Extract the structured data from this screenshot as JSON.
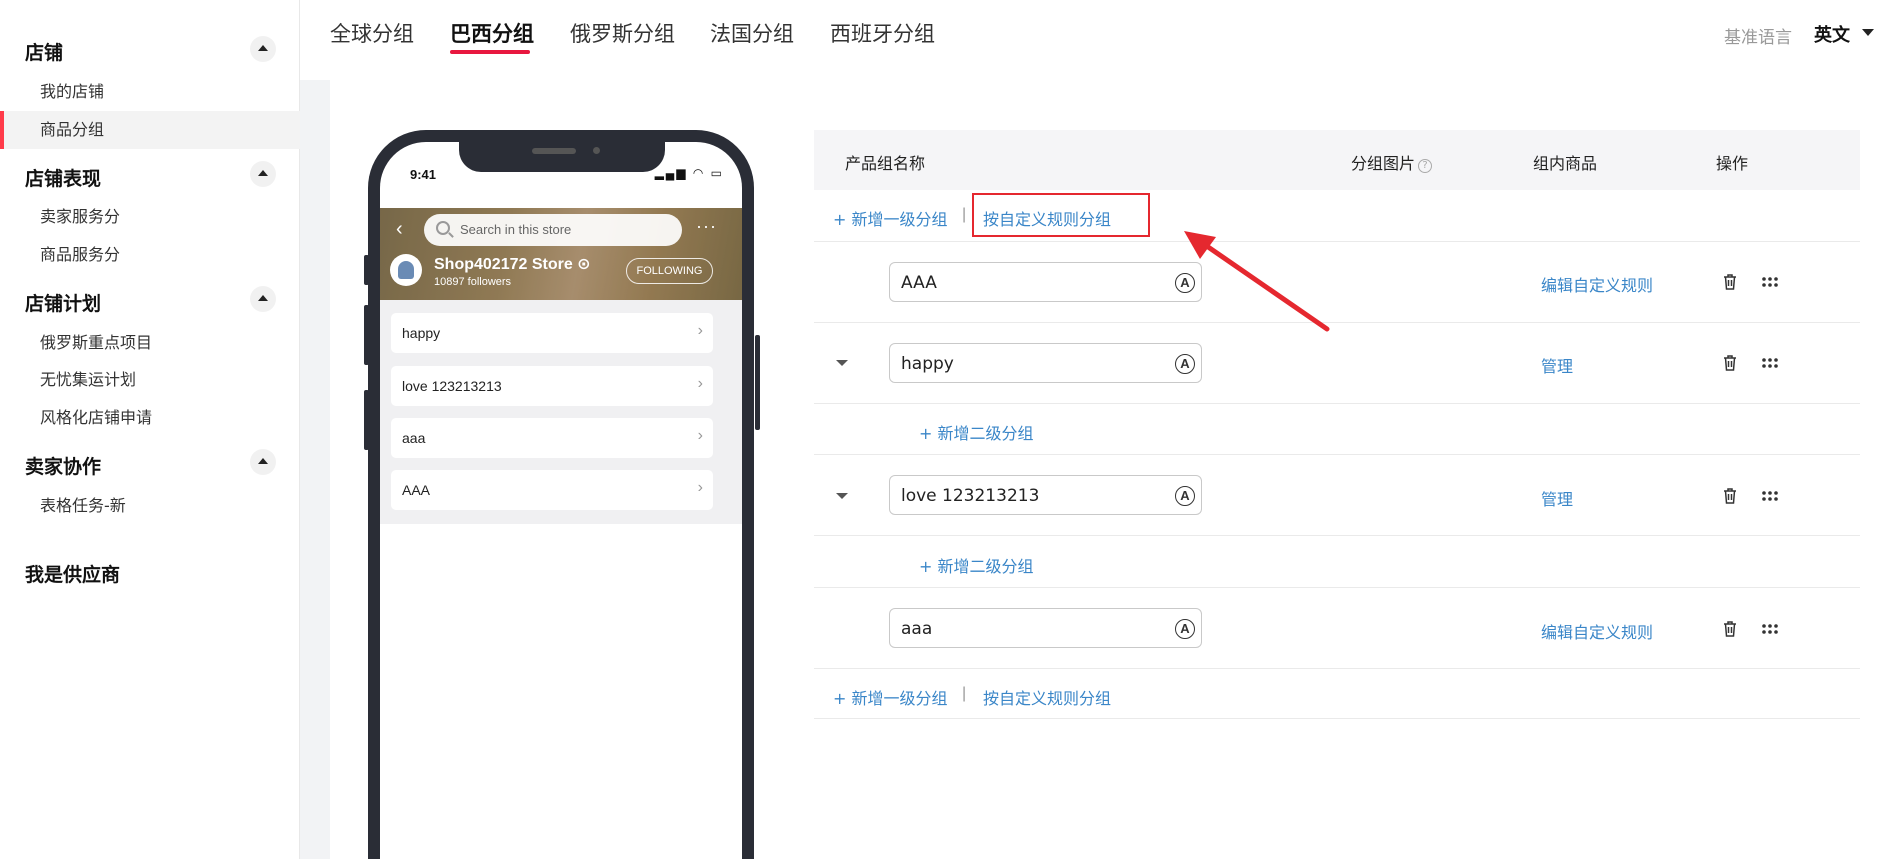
{
  "sidebar": {
    "sections": [
      {
        "title": "店铺",
        "items": [
          {
            "label": "我的店铺"
          },
          {
            "label": "商品分组",
            "active": true
          }
        ]
      },
      {
        "title": "店铺表现",
        "items": [
          {
            "label": "卖家服务分"
          },
          {
            "label": "商品服务分"
          }
        ]
      },
      {
        "title": "店铺计划",
        "items": [
          {
            "label": "俄罗斯重点项目"
          },
          {
            "label": "无忧集运计划"
          },
          {
            "label": "风格化店铺申请"
          }
        ]
      },
      {
        "title": "卖家协作",
        "items": [
          {
            "label": "表格任务-新"
          }
        ]
      }
    ],
    "supplier": "我是供应商"
  },
  "tabs": [
    {
      "label": "全球分组",
      "active": false
    },
    {
      "label": "巴西分组",
      "active": true
    },
    {
      "label": "俄罗斯分组",
      "active": false
    },
    {
      "label": "法国分组",
      "active": false
    },
    {
      "label": "西班牙分组",
      "active": false
    }
  ],
  "language": {
    "label": "基准语言",
    "value": "英文"
  },
  "phone": {
    "time": "9:41",
    "status_icons": "▂▄▆ ◠ ▭",
    "search_placeholder": "Search in this store",
    "more": "···",
    "back": "‹",
    "store_name": "Shop402172 Store ⊙",
    "followers": "10897  followers",
    "following_label": "FOLLOWING",
    "categories": [
      {
        "label": "happy"
      },
      {
        "label": "love 123213213"
      },
      {
        "label": "aaa"
      },
      {
        "label": "AAA"
      }
    ],
    "chevron": "›"
  },
  "table": {
    "headers": {
      "name": "产品组名称",
      "image": "分组图片",
      "image_help": "?",
      "products": "组内商品",
      "ops": "操作"
    },
    "add_first_level": "+ 新增一级分组",
    "separator": "|",
    "custom_rule_group": "按自定义规则分组",
    "add_second_level": "+ 新增二级分组",
    "translate_glyph": "A",
    "rows": [
      {
        "name": "AAA",
        "expandable": false,
        "action": "编辑自定义规则"
      },
      {
        "name": "happy",
        "expandable": true,
        "action": "管理"
      },
      {
        "name": "love 123213213",
        "expandable": true,
        "action": "管理"
      },
      {
        "name": "aaa",
        "expandable": false,
        "action": "编辑自定义规则"
      }
    ]
  },
  "colors": {
    "accent": "#e8173f",
    "link": "#3a86c8",
    "highlight": "#e5282f",
    "active_bar": "#ff3b4a"
  }
}
